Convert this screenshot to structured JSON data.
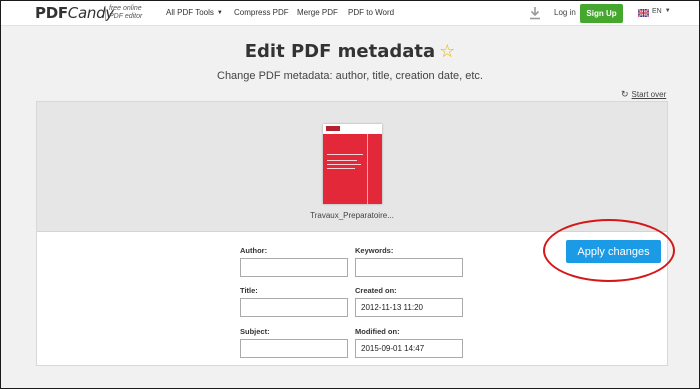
{
  "header": {
    "logo_bold": "PDF",
    "logo_italic": "Candy",
    "tagline_line1": "free online",
    "tagline_line2": "PDF editor",
    "nav": [
      {
        "label": "All PDF Tools"
      },
      {
        "label": "Compress PDF"
      },
      {
        "label": "Merge PDF"
      },
      {
        "label": "PDF to Word"
      }
    ],
    "login_label": "Log in",
    "signup_label": "Sign Up",
    "lang_label": "EN"
  },
  "page": {
    "title": "Edit PDF metadata",
    "star": "☆",
    "subtitle": "Change PDF metadata: author, title, creation date, etc.",
    "start_over": "Start over"
  },
  "file": {
    "name": "Travaux_Preparatoire..."
  },
  "form": {
    "author": {
      "label": "Author:",
      "value": ""
    },
    "keywords": {
      "label": "Keywords:",
      "value": ""
    },
    "title": {
      "label": "Title:",
      "value": ""
    },
    "created": {
      "label": "Created on:",
      "value": "2012-11-13 11:20"
    },
    "subject": {
      "label": "Subject:",
      "value": ""
    },
    "modified": {
      "label": "Modified on:",
      "value": "2015-09-01 14:47"
    }
  },
  "apply_label": "Apply changes",
  "colors": {
    "signup_green": "#45a72e",
    "apply_blue": "#1b9ae6",
    "highlight_red": "#d41818",
    "thumb_red": "#e3283a"
  },
  "icons": [
    "caret-down-icon",
    "download-icon",
    "flag-uk-icon",
    "star-icon",
    "refresh-icon"
  ]
}
